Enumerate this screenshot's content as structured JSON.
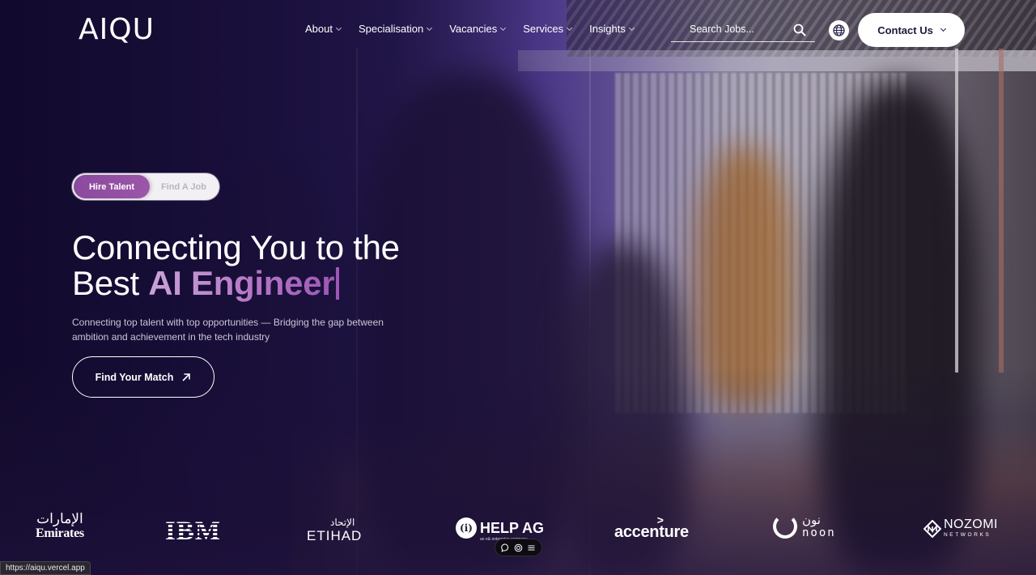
{
  "header": {
    "logo": "AIQU",
    "nav": [
      {
        "label": "About"
      },
      {
        "label": "Specialisation"
      },
      {
        "label": "Vacancies"
      },
      {
        "label": "Services"
      },
      {
        "label": "Insights"
      }
    ],
    "search": {
      "placeholder": "Search Jobs...",
      "value": "",
      "icon": "search-icon"
    },
    "language_icon": "globe-icon",
    "contact_label": "Contact Us"
  },
  "hero": {
    "toggle": {
      "options": [
        "Hire Talent",
        "Find A Job"
      ],
      "selected": "Hire Talent"
    },
    "headline_line1": "Connecting You to the",
    "headline_prefix": "Best ",
    "headline_accent": "AI Engineer",
    "subtext": "Connecting top talent with top opportunities — Bridging the gap between ambition and achievement in the tech industry",
    "cta_label": "Find Your Match",
    "cta_icon": "arrow-up-right-icon"
  },
  "clients": [
    {
      "name": "Emirates",
      "arabic": "الإمارات"
    },
    {
      "name": "IBM"
    },
    {
      "name": "ETIHAD",
      "arabic": "الإتحاد"
    },
    {
      "name": "HELP AG",
      "badge": "(i)",
      "sub": "an e& enterprise company"
    },
    {
      "name": "accenture",
      "mark": ">"
    },
    {
      "name": "noon",
      "arabic": "نون"
    },
    {
      "name": "NOZOMI",
      "sub": "NETWORKS"
    }
  ],
  "floating_toolbar": {
    "icons": [
      "comment-icon",
      "copyright-icon",
      "menu-icon"
    ]
  },
  "status_bar": {
    "url": "https://aiqu.vercel.app"
  },
  "colors": {
    "accent_purple": "#9b56a8",
    "background_dark": "#140b2e",
    "button_text": "#1e1a3a"
  }
}
